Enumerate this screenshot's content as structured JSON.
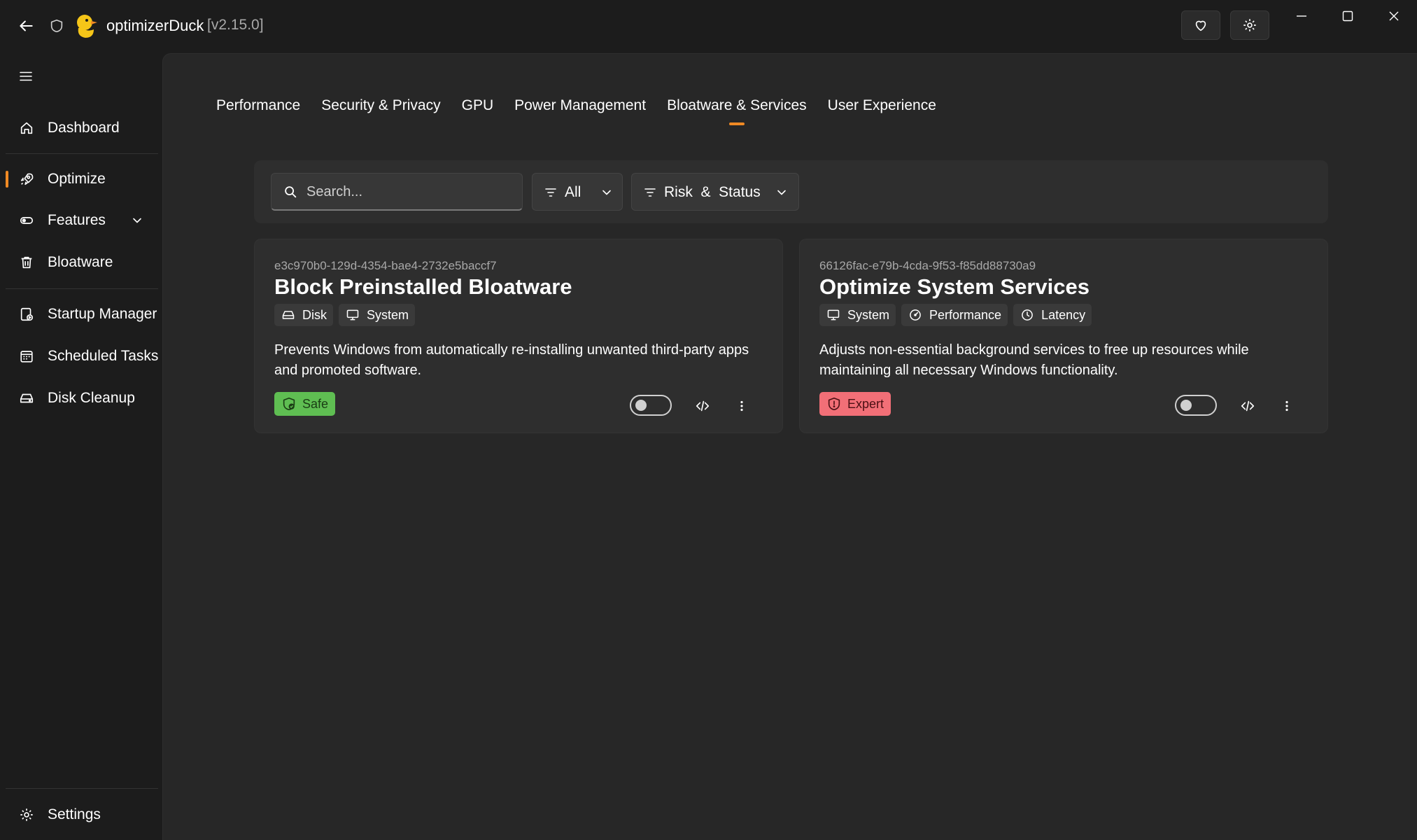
{
  "app": {
    "name": "optimizerDuck",
    "version": "[v2.15.0]"
  },
  "colors": {
    "accent": "#f08a24",
    "safe": "#5fbe52",
    "expert": "#f26f77"
  },
  "titlebar": {
    "icons": [
      "back-arrow-icon",
      "shield-icon",
      "duck-logo-icon",
      "heart-icon",
      "settings-gear-icon",
      "minimize-icon",
      "maximize-icon",
      "close-icon"
    ]
  },
  "sidebar": {
    "menu_icon": "hamburger-icon",
    "items": [
      {
        "label": "Dashboard",
        "icon": "home-icon"
      },
      {
        "label": "Optimize",
        "icon": "rocket-icon",
        "selected": true
      },
      {
        "label": "Features",
        "icon": "toggle-icon",
        "expandable": true
      },
      {
        "label": "Bloatware",
        "icon": "trash-icon"
      },
      {
        "label": "Startup Manager",
        "icon": "startup-icon"
      },
      {
        "label": "Scheduled Tasks",
        "icon": "calendar-icon"
      },
      {
        "label": "Disk Cleanup",
        "icon": "disk-icon"
      },
      {
        "label": "Settings",
        "icon": "gear-icon"
      }
    ]
  },
  "tabs": [
    {
      "label": "Performance"
    },
    {
      "label": "Security & Privacy"
    },
    {
      "label": "GPU"
    },
    {
      "label": "Power Management"
    },
    {
      "label": "Bloatware & Services",
      "active": true
    },
    {
      "label": "User Experience"
    }
  ],
  "filters": {
    "search_placeholder": "Search...",
    "category_label": "All",
    "risk_label": "Risk  &  Status"
  },
  "cards": [
    {
      "id": "e3c970b0-129d-4354-bae4-2732e5baccf7",
      "title": "Block Preinstalled Bloatware",
      "tags": [
        {
          "label": "Disk",
          "icon": "disk-icon"
        },
        {
          "label": "System",
          "icon": "monitor-icon"
        }
      ],
      "description": "Prevents Windows from automatically re-installing unwanted third-party apps and promoted software.",
      "badge": {
        "label": "Safe",
        "kind": "safe",
        "icon": "shield-check-icon"
      },
      "enabled": false
    },
    {
      "id": "66126fac-e79b-4cda-9f53-f85dd88730a9",
      "title": "Optimize System Services",
      "tags": [
        {
          "label": "System",
          "icon": "monitor-icon"
        },
        {
          "label": "Performance",
          "icon": "gauge-icon"
        },
        {
          "label": "Latency",
          "icon": "clock-icon"
        }
      ],
      "description": "Adjusts non-essential background services to free up resources while maintaining all necessary Windows functionality.",
      "badge": {
        "label": "Expert",
        "kind": "expert",
        "icon": "shield-alert-icon"
      },
      "enabled": false
    }
  ]
}
